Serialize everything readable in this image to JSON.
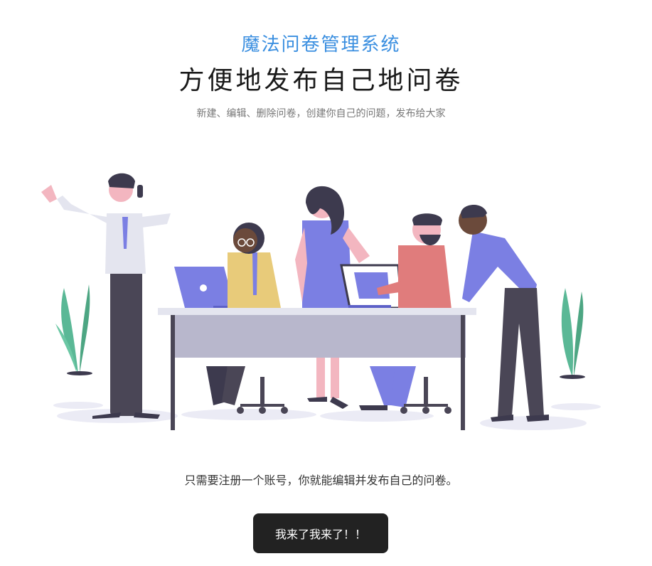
{
  "header": {
    "brand": "魔法问卷管理系统",
    "title": "方便地发布自己地问卷",
    "description": "新建、编辑、删除问卷，创建你自己的问题，发布给大家"
  },
  "illustration": {
    "icon": "team-working-illustration"
  },
  "cta": {
    "text": "只需要注册一个账号，你就能编辑并发布自己的问卷。",
    "button_label": "我来了我来了！！"
  },
  "colors": {
    "brand_blue": "#3b8fe0",
    "button_bg": "#222222",
    "accent_purple": "#7b7fe3"
  }
}
